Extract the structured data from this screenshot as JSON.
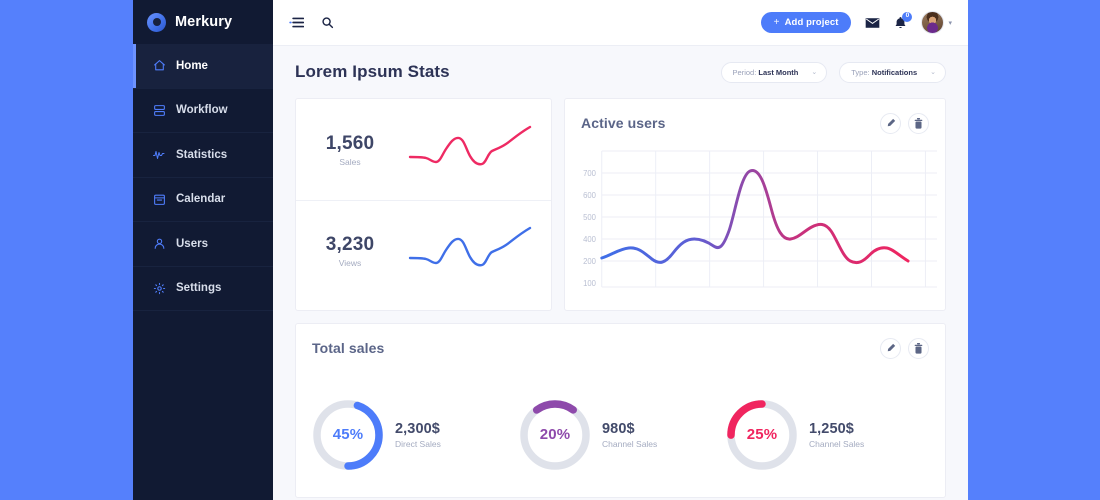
{
  "theme": {
    "page_background": "#5580fc",
    "sidebar_background": "#111a33",
    "accent_blue": "#4d7cfa",
    "accent_pink": "#ee2a63",
    "accent_purple": "#8e4aab",
    "content_background": "#f7f8fc"
  },
  "sidebar": {
    "brand": {
      "name": "Merkury",
      "logo_icon": "ring-logo-icon"
    },
    "items": [
      {
        "label": "Home",
        "icon": "home-icon",
        "active": true
      },
      {
        "label": "Workflow",
        "icon": "workflow-icon",
        "active": false
      },
      {
        "label": "Statistics",
        "icon": "statistics-icon",
        "active": false
      },
      {
        "label": "Calendar",
        "icon": "calendar-icon",
        "active": false
      },
      {
        "label": "Users",
        "icon": "users-icon",
        "active": false
      },
      {
        "label": "Settings",
        "icon": "settings-icon",
        "active": false
      }
    ]
  },
  "topbar": {
    "menu_icon": "hamburger-collapse-icon",
    "search_icon": "search-icon",
    "add_project_label": "Add project",
    "add_project_plus": "+",
    "mail_icon": "mail-icon",
    "bell_icon": "bell-icon",
    "notification_count": "0",
    "avatar_icon": "user-avatar",
    "caret": "▾"
  },
  "page": {
    "title": "Lorem Ipsum Stats",
    "filters": [
      {
        "label": "Period:",
        "value": "Last Month",
        "chevron": "⌄"
      },
      {
        "label": "Type:",
        "value": "Notifications",
        "chevron": "⌄"
      }
    ]
  },
  "stats": [
    {
      "number": "1,560",
      "label": "Sales",
      "color": "#ee2a63"
    },
    {
      "number": "3,230",
      "label": "Views",
      "color": "#3f6fe8"
    }
  ],
  "active_users_card": {
    "title": "Active users",
    "edit_icon": "pencil-icon",
    "delete_icon": "trash-icon"
  },
  "total_sales_card": {
    "title": "Total sales",
    "edit_icon": "pencil-icon",
    "delete_icon": "trash-icon"
  },
  "donuts": [
    {
      "percent_label": "45%",
      "percent": 45,
      "amount": "2,300$",
      "sub": "Direct Sales",
      "color": "#4d7cfa"
    },
    {
      "percent_label": "20%",
      "percent": 20,
      "amount": "980$",
      "sub": "Channel Sales",
      "color": "#8e4aab"
    },
    {
      "percent_label": "25%",
      "percent": 25,
      "amount": "1,250$",
      "sub": "Channel Sales",
      "color": "#f0255f"
    }
  ],
  "chart_data": [
    {
      "type": "line",
      "title": "Active users",
      "xlabel": "",
      "ylabel": "",
      "ylim": [
        100,
        750
      ],
      "yticks": [
        100,
        200,
        300,
        400,
        500,
        600,
        700
      ],
      "grid": true,
      "legend": "none",
      "gradient_stops": [
        "#3f6fe8",
        "#8e4aab",
        "#f0255f"
      ],
      "x": [
        0,
        1,
        2,
        3,
        4,
        5,
        6,
        7,
        8,
        9,
        10,
        11,
        12,
        13,
        14,
        15,
        16,
        17,
        18
      ],
      "values": [
        270,
        300,
        315,
        290,
        255,
        280,
        360,
        390,
        380,
        360,
        420,
        600,
        705,
        560,
        405,
        430,
        455,
        420,
        300
      ]
    },
    {
      "type": "line",
      "title": "Sales sparkline",
      "ylim": [
        0,
        100
      ],
      "grid": false,
      "legend": "none",
      "color": "#ee2a63",
      "values": [
        40,
        40,
        34,
        30,
        38,
        62,
        52,
        28,
        30,
        48,
        56,
        66,
        82
      ]
    },
    {
      "type": "line",
      "title": "Views sparkline",
      "ylim": [
        0,
        100
      ],
      "grid": false,
      "legend": "none",
      "color": "#3f6fe8",
      "values": [
        40,
        40,
        34,
        30,
        38,
        62,
        52,
        28,
        30,
        48,
        56,
        66,
        82
      ]
    },
    {
      "type": "pie",
      "title": "Total sales",
      "labels": [
        "Direct Sales",
        "Channel Sales",
        "Channel Sales"
      ],
      "values": [
        45,
        20,
        25
      ],
      "amounts": [
        "2,300$",
        "980$",
        "1,250$"
      ],
      "colors": [
        "#4d7cfa",
        "#8e4aab",
        "#f0255f"
      ]
    }
  ]
}
